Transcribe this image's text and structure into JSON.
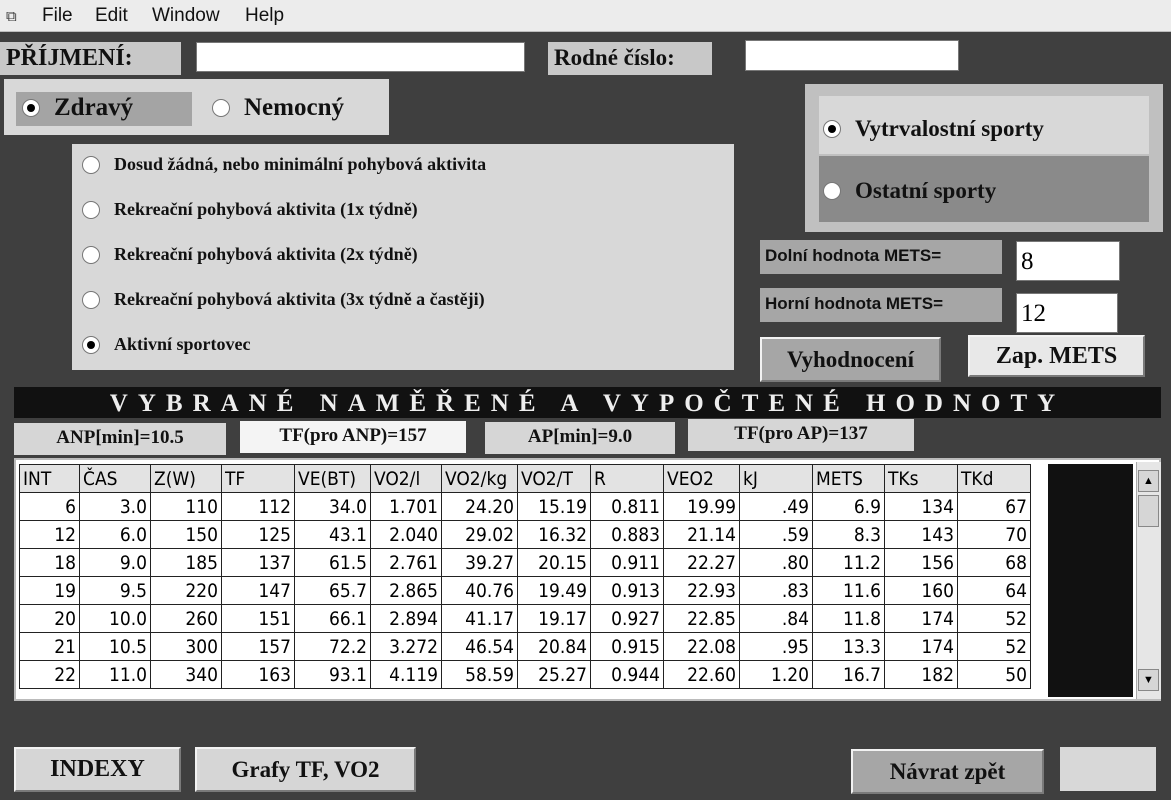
{
  "menu": {
    "items": [
      "File",
      "Edit",
      "Window",
      "Help"
    ]
  },
  "patient": {
    "surname_label": "PŘÍJMENÍ:",
    "surname_value": "",
    "birth_label": "Rodné číslo:",
    "birth_value": ""
  },
  "health": {
    "healthy": "Zdravý",
    "sick": "Nemocný"
  },
  "activity": {
    "options": [
      "Dosud žádná, nebo minimální pohybová aktivita",
      "Rekreační pohybová aktivita (1x týdně)",
      "Rekreační pohybová aktivita (2x týdně)",
      "Rekreační pohybová aktivita (3x týdně a častěji)",
      "Aktivní sportovec"
    ]
  },
  "sport": {
    "endurance": "Vytrvalostní sporty",
    "other": "Ostatní sporty"
  },
  "mets": {
    "lower_label": "Dolní hodnota METS=",
    "lower_value": "8",
    "upper_label": "Horní hodnota METS=",
    "upper_value": "12"
  },
  "buttons": {
    "evaluate": "Vyhodnocení",
    "write_mets": "Zap. METS",
    "indexes": "INDEXY",
    "graphs": "Grafy TF, VO2",
    "back": "Návrat zpět"
  },
  "section_title": "VYBRANÉ NAMĚŘENÉ A VYPOČTENÉ HODNOTY",
  "summary": {
    "anp": "ANP[min]=10.5",
    "tf_anp": "TF(pro ANP)=157",
    "ap": "AP[min]=9.0",
    "tf_ap": "TF(pro AP)=137"
  },
  "table": {
    "columns": [
      "INT",
      "ČAS",
      "Z(W)",
      "TF",
      "VE(BT)",
      "VO2/l",
      "VO2/kg",
      "VO2/T",
      "R",
      "VEO2",
      "kJ",
      "METS",
      "TKs",
      "TKd"
    ],
    "rows": [
      [
        "6",
        "3.0",
        "110",
        "112",
        "34.0",
        "1.701",
        "24.20",
        "15.19",
        "0.811",
        "19.99",
        ".49",
        "6.9",
        "134",
        "67"
      ],
      [
        "12",
        "6.0",
        "150",
        "125",
        "43.1",
        "2.040",
        "29.02",
        "16.32",
        "0.883",
        "21.14",
        ".59",
        "8.3",
        "143",
        "70"
      ],
      [
        "18",
        "9.0",
        "185",
        "137",
        "61.5",
        "2.761",
        "39.27",
        "20.15",
        "0.911",
        "22.27",
        ".80",
        "11.2",
        "156",
        "68"
      ],
      [
        "19",
        "9.5",
        "220",
        "147",
        "65.7",
        "2.865",
        "40.76",
        "19.49",
        "0.913",
        "22.93",
        ".83",
        "11.6",
        "160",
        "64"
      ],
      [
        "20",
        "10.0",
        "260",
        "151",
        "66.1",
        "2.894",
        "41.17",
        "19.17",
        "0.927",
        "22.85",
        ".84",
        "11.8",
        "174",
        "52"
      ],
      [
        "21",
        "10.5",
        "300",
        "157",
        "72.2",
        "3.272",
        "46.54",
        "20.84",
        "0.915",
        "22.08",
        ".95",
        "13.3",
        "174",
        "52"
      ],
      [
        "22",
        "11.0",
        "340",
        "163",
        "93.1",
        "4.119",
        "58.59",
        "25.27",
        "0.944",
        "22.60",
        "1.20",
        "16.7",
        "182",
        "50"
      ]
    ]
  }
}
